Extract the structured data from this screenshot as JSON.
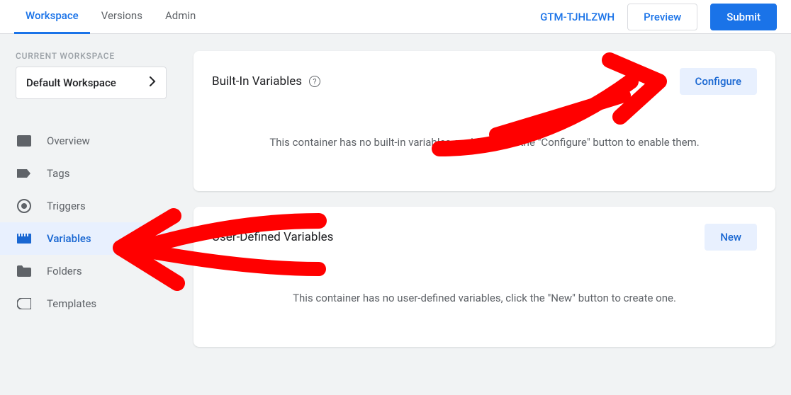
{
  "tabs": {
    "workspace": "Workspace",
    "versions": "Versions",
    "admin": "Admin"
  },
  "containerId": "GTM-TJHLZWH",
  "buttons": {
    "preview": "Preview",
    "submit": "Submit"
  },
  "sidebar": {
    "currentWorkspaceLabel": "CURRENT WORKSPACE",
    "workspaceName": "Default Workspace",
    "nav": {
      "overview": "Overview",
      "tags": "Tags",
      "triggers": "Triggers",
      "variables": "Variables",
      "folders": "Folders",
      "templates": "Templates"
    }
  },
  "cards": {
    "builtIn": {
      "title": "Built-In Variables",
      "action": "Configure",
      "emptyText": "This container has no built-in variables enabled, click the \"Configure\" button to enable them."
    },
    "userDefined": {
      "title": "User-Defined Variables",
      "action": "New",
      "emptyText": "This container has no user-defined variables, click the \"New\" button to create one."
    }
  }
}
